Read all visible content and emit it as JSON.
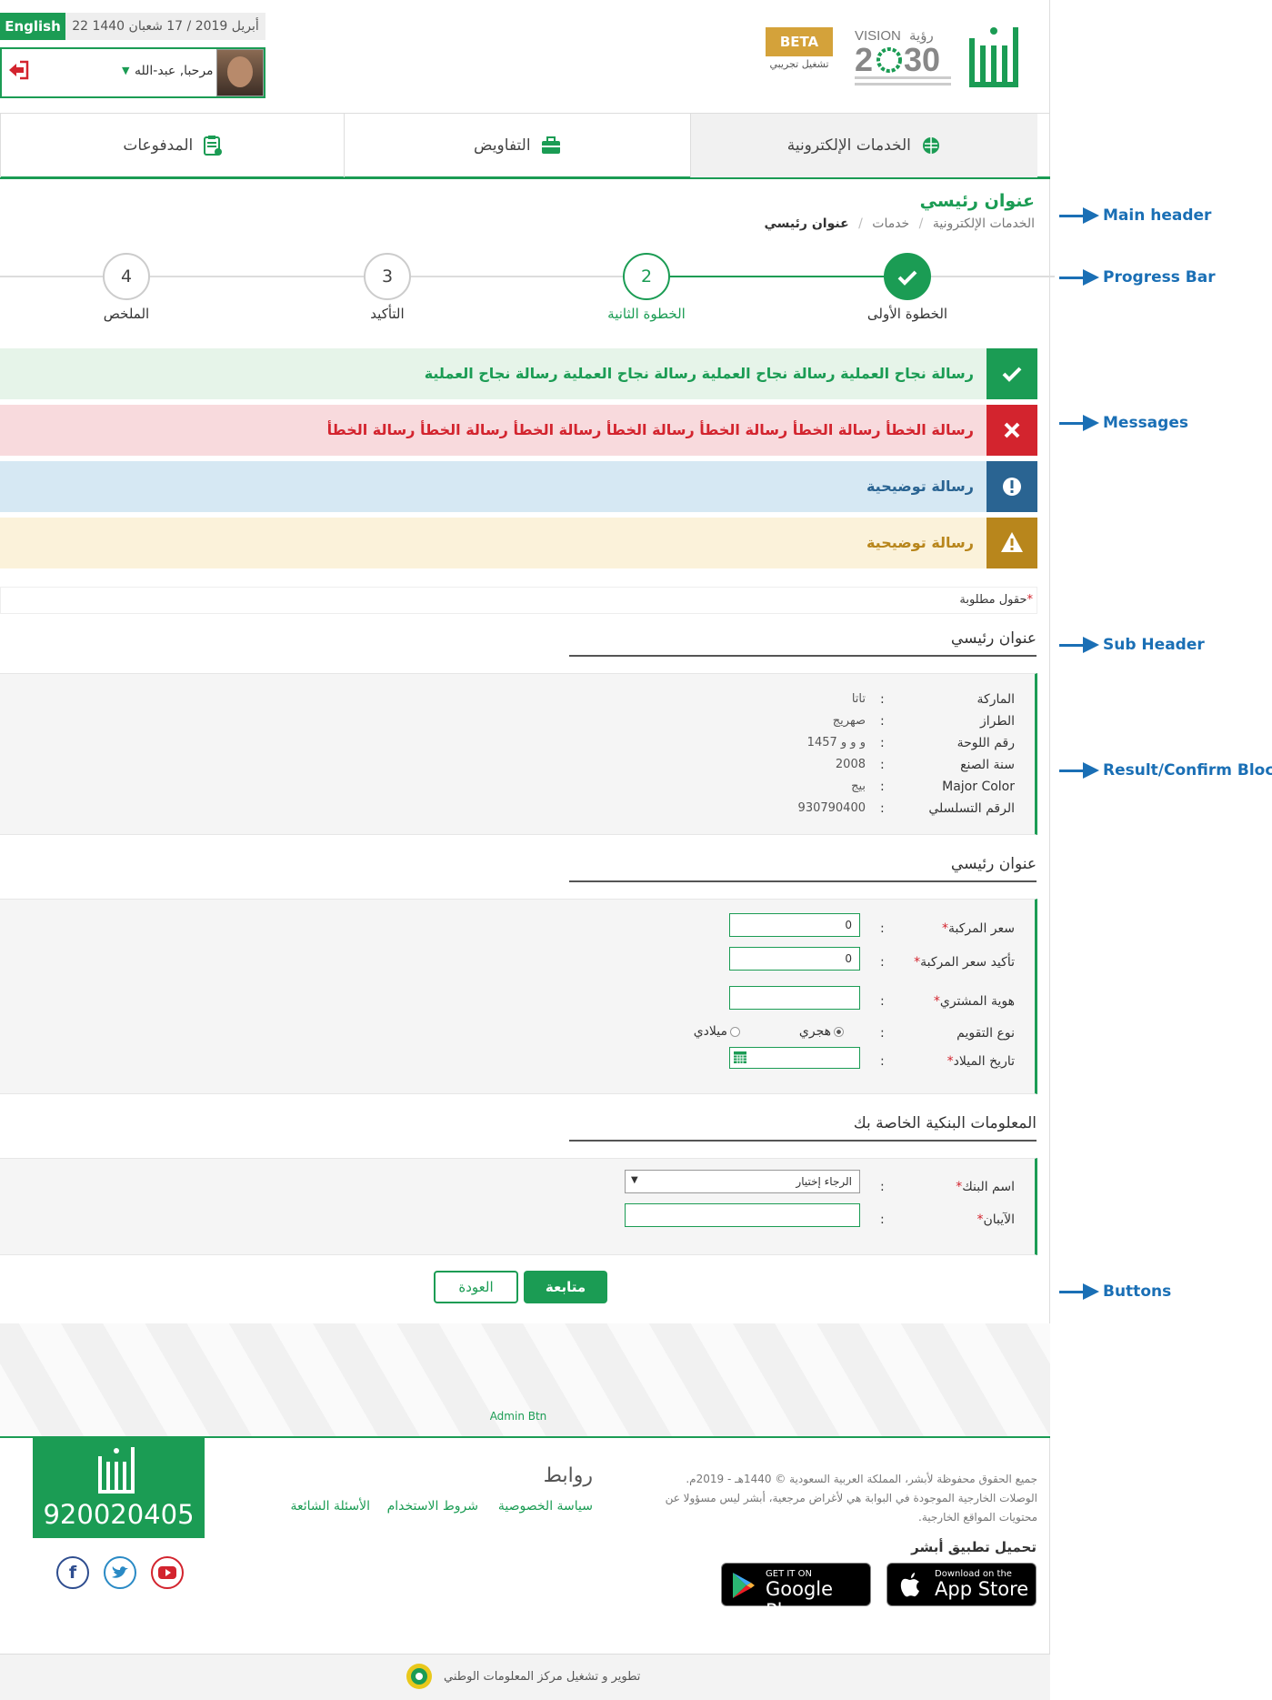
{
  "header": {
    "language_button": "English",
    "date": "22 أبريل 2019 / 17 شعبان 1440",
    "user_greeting": "مرحبا, عبد-الله",
    "beta_label": "BETA",
    "beta_sub": "تشغيل تجريبي",
    "vision_logo": "VISION 2030 رؤية",
    "logo": "أبشر"
  },
  "tabs": [
    {
      "label": "الخدمات الإلكترونية",
      "icon": "globe-icon"
    },
    {
      "label": "التفاويض",
      "icon": "briefcase-icon"
    },
    {
      "label": "المدفوعات",
      "icon": "clipboard-icon"
    }
  ],
  "page": {
    "title": "عنوان رئيسي",
    "breadcrumb": [
      "الخدمات الإلكترونية",
      "خدمات",
      "عنوان رئيسي"
    ]
  },
  "steps": [
    {
      "label": "الخطوة الأولى",
      "number": "1",
      "state": "done"
    },
    {
      "label": "الخطوة الثانية",
      "number": "2",
      "state": "active"
    },
    {
      "label": "التأكيد",
      "number": "3",
      "state": "pending"
    },
    {
      "label": "الملخص",
      "number": "4",
      "state": "pending"
    }
  ],
  "messages": {
    "success": "رسالة نجاح العملية رسالة نجاح العملية رسالة نجاح العملية رسالة نجاح العملية",
    "error": "رسالة الخطأ رسالة الخطأ رسالة الخطأ رسالة الخطأ رسالة الخطأ رسالة الخطأ رسالة الخطأ",
    "info": "رسالة توضيحية",
    "warning": "رسالة توضيحية"
  },
  "required_note": "حقول مطلوبة",
  "required_mark": "*",
  "section1": {
    "title": "عنوان رئيسي",
    "rows": [
      {
        "label": "الماركة",
        "value": "تاتا"
      },
      {
        "label": "الطراز",
        "value": "صهريج"
      },
      {
        "label": "رقم اللوحة",
        "value": "و و و 1457"
      },
      {
        "label": "سنة الصنع",
        "value": "2008"
      },
      {
        "label": "Major Color",
        "value": "بيج"
      },
      {
        "label": "الرقم التسلسلي",
        "value": "930790400"
      }
    ]
  },
  "section2": {
    "title": "عنوان رئيسي",
    "price_label": "سعر المركبة",
    "price_value": "0",
    "price_confirm_label": "تأكيد سعر المركبة",
    "price_confirm_value": "0",
    "buyer_id_label": "هوية المشتري",
    "buyer_id_value": "",
    "calendar_label": "نوع التقويم",
    "calendar_options": [
      "هجري",
      "ميلادي"
    ],
    "calendar_selected": "هجري",
    "birth_label": "تاريخ الميلاد"
  },
  "section3": {
    "title": "المعلومات البنكية الخاصة بك",
    "bank_label": "اسم البنك",
    "bank_selected": "الرجاء إختيار",
    "iban_label": "الآيبان",
    "iban_value": ""
  },
  "buttons": {
    "continue": "متابعة",
    "back": "العودة",
    "admin": "Admin Btn"
  },
  "footer": {
    "phone": "920020405",
    "links_title": "روابط",
    "links": [
      "سياسة الخصوصية",
      "شروط الاستخدام",
      "الأسئلة الشائعة"
    ],
    "copyright_lines": [
      "جميع الحقوق محفوظة لأبشر، المملكة العربية السعودية © 1440هـ - 2019م.",
      "الوصلات الخارجية الموجودة في البوابة هي لأغراض مرجعية، أبشر ليس مسؤولا عن",
      "محتويات المواقع الخارجية."
    ],
    "app_title": "تحميل تطبيق أبشر",
    "app_store_small": "Download on the",
    "app_store_big": "App Store",
    "google_small": "GET IT ON",
    "google_big": "Google Play",
    "social": [
      "facebook-icon",
      "twitter-icon",
      "youtube-icon"
    ],
    "bottom": "تطوير و تشغيل مركز المعلومات الوطني"
  },
  "annotations": [
    "Main header",
    "Progress Bar",
    "Messages",
    "Sub Header",
    "Result/Confirm Blocks",
    "Buttons"
  ],
  "colors": {
    "brand": "#1b9c54",
    "error": "#d3242e",
    "info": "#2a6492",
    "warning": "#b8861c",
    "annotation": "#1a6fb5"
  }
}
